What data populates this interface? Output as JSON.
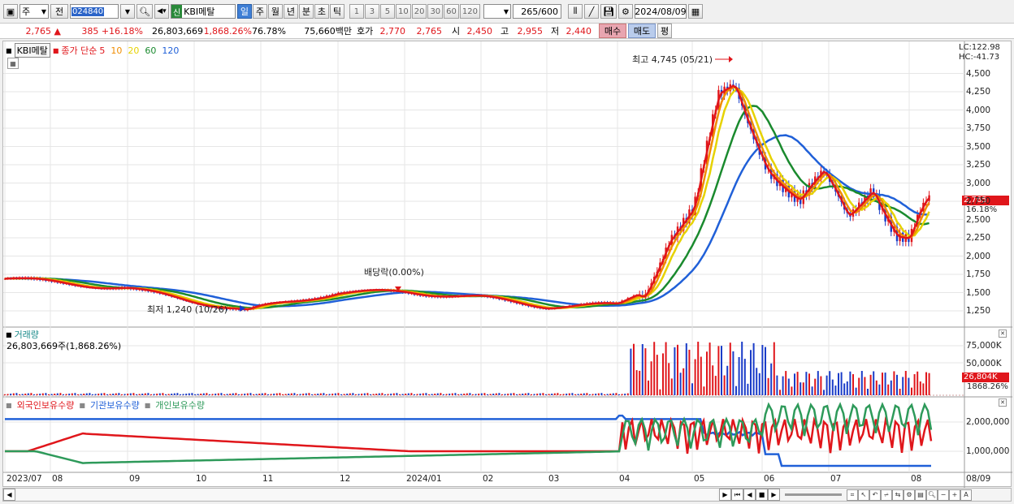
{
  "toolbar": {
    "period_type": "주",
    "prev_label": "전",
    "code": "024840",
    "market_tag": "신",
    "name": "KBI메탈",
    "period_tabs": [
      {
        "label": "일",
        "selected": true
      },
      {
        "label": "주",
        "selected": false
      },
      {
        "label": "월",
        "selected": false
      },
      {
        "label": "년",
        "selected": false
      },
      {
        "label": "분",
        "selected": false
      },
      {
        "label": "초",
        "selected": false
      },
      {
        "label": "틱",
        "selected": false
      }
    ],
    "intervals": [
      "1",
      "3",
      "5",
      "10",
      "20",
      "30",
      "60",
      "120"
    ],
    "count": "265",
    "count_total": "/600",
    "date": "2024/08/09"
  },
  "quote": {
    "price": "2,765",
    "change_arrow": "▲",
    "change": "385",
    "change_pct": "+16.18%",
    "volume": "26,803,669",
    "volume_pct": "1,868.26%",
    "ratio": "76.78%",
    "amount": "75,660백만",
    "hoga_label": "호가",
    "ask": "2,770",
    "bid": "2,765",
    "open_label": "시",
    "open": "2,450",
    "high_label": "고",
    "high": "2,955",
    "low_label": "저",
    "low": "2,440",
    "buy_label": "매수",
    "sell_label": "매도",
    "close_label": "평"
  },
  "price_panel": {
    "name_tag": "KBI메탈",
    "legend_type": "종가 단순",
    "ma_labels": [
      {
        "label": "5",
        "color": "#e0161b"
      },
      {
        "label": "10",
        "color": "#f08c00"
      },
      {
        "label": "20",
        "color": "#e6d200"
      },
      {
        "label": "60",
        "color": "#1a8a2e"
      },
      {
        "label": "120",
        "color": "#2060d8"
      }
    ],
    "lc": "LC:122.98",
    "hc": "HC:-41.73",
    "y_ticks": [
      "4,500",
      "4,250",
      "4,000",
      "3,750",
      "3,500",
      "3,250",
      "3,000",
      "2,750",
      "2,500",
      "2,250",
      "2,000",
      "1,750",
      "1,500",
      "1,250"
    ],
    "high_note": "최고 4,745 (05/21)",
    "low_note": "최저 1,240 (10/26)",
    "dividend_note": "배당락(0.00%)",
    "last_price_tag": "2,765",
    "last_pct_tag": "16.18%"
  },
  "volume_panel": {
    "title": "거래량",
    "value": "26,803,669주(1,868.26%)",
    "y_ticks": [
      "75,000K",
      "50,000K"
    ],
    "last_tag": "26,804K",
    "last_pct": "1868.26%"
  },
  "holdings_panel": {
    "series": [
      {
        "label": "외국인보유수량",
        "color": "#e0161b"
      },
      {
        "label": "기관보유수량",
        "color": "#2060d8"
      },
      {
        "label": "개인보유수량",
        "color": "#2e9a5a"
      }
    ],
    "y_ticks": [
      "2,000,000",
      "1,000,000"
    ]
  },
  "x_axis": [
    "2023/07",
    "08",
    "09",
    "10",
    "11",
    "12",
    "2024/01",
    "02",
    "03",
    "04",
    "05",
    "06",
    "07",
    "08",
    "08/09"
  ],
  "colors": {
    "up": "#e0161b",
    "down": "#1a3cc8",
    "ma5": "#e0161b",
    "ma10": "#f08c00",
    "ma20": "#e6d200",
    "ma60": "#1a8a2e",
    "ma120": "#2060d8"
  }
}
